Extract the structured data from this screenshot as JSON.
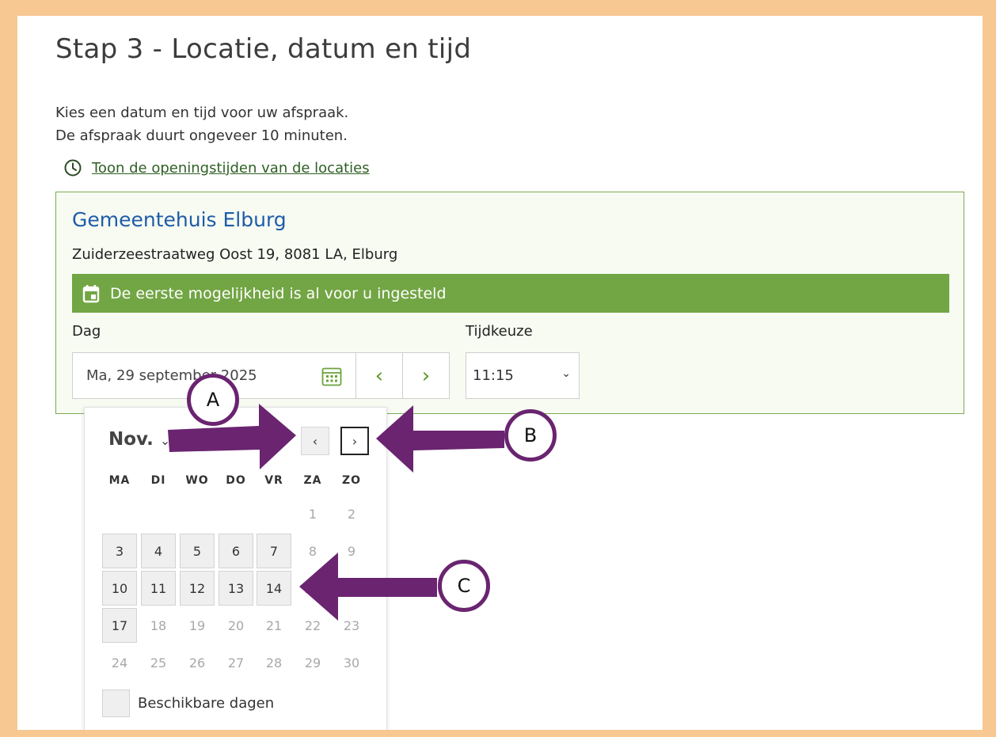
{
  "page": {
    "title": "Stap 3 - Locatie, datum en tijd"
  },
  "intro": {
    "line1": "Kies een datum en tijd voor uw afspraak.",
    "line2": "De afspraak duurt ongeveer 10 minuten."
  },
  "hours_link": {
    "icon": "clock-icon",
    "label": "Toon de openingstijden van de locaties"
  },
  "location": {
    "name": "Gemeentehuis Elburg",
    "address": "Zuiderzeestraatweg Oost 19, 8081 LA, Elburg",
    "notice": "De eerste mogelijkheid is al voor u ingesteld",
    "notice_icon": "calendar-icon",
    "accent_color": "#72a544"
  },
  "form": {
    "day_label": "Dag",
    "day_value": "Ma, 29 september 2025",
    "prev_label": "‹",
    "next_label": "›",
    "time_label": "Tijdkeuze",
    "time_value": "11:15"
  },
  "datepicker": {
    "month": "Nov.",
    "prev": "‹",
    "next": "›",
    "weekdays": [
      "MA",
      "DI",
      "WO",
      "DO",
      "VR",
      "ZA",
      "ZO"
    ],
    "rows": [
      [
        "",
        "",
        "",
        "",
        "",
        "1",
        "2"
      ],
      [
        "3",
        "4",
        "5",
        "6",
        "7",
        "8",
        "9"
      ],
      [
        "10",
        "11",
        "12",
        "13",
        "14",
        "22",
        "23"
      ],
      [
        "17",
        "18",
        "19",
        "20",
        "21",
        "22",
        "23"
      ],
      [
        "24",
        "25",
        "26",
        "27",
        "28",
        "29",
        "30"
      ]
    ],
    "available": [
      "3",
      "4",
      "5",
      "6",
      "7",
      "10",
      "11",
      "12",
      "13",
      "14",
      "17"
    ],
    "legend_label": "Beschikbare dagen"
  },
  "annotations": {
    "marker_a": "A",
    "marker_b": "B",
    "marker_c": "C",
    "color": "#6a2470"
  }
}
